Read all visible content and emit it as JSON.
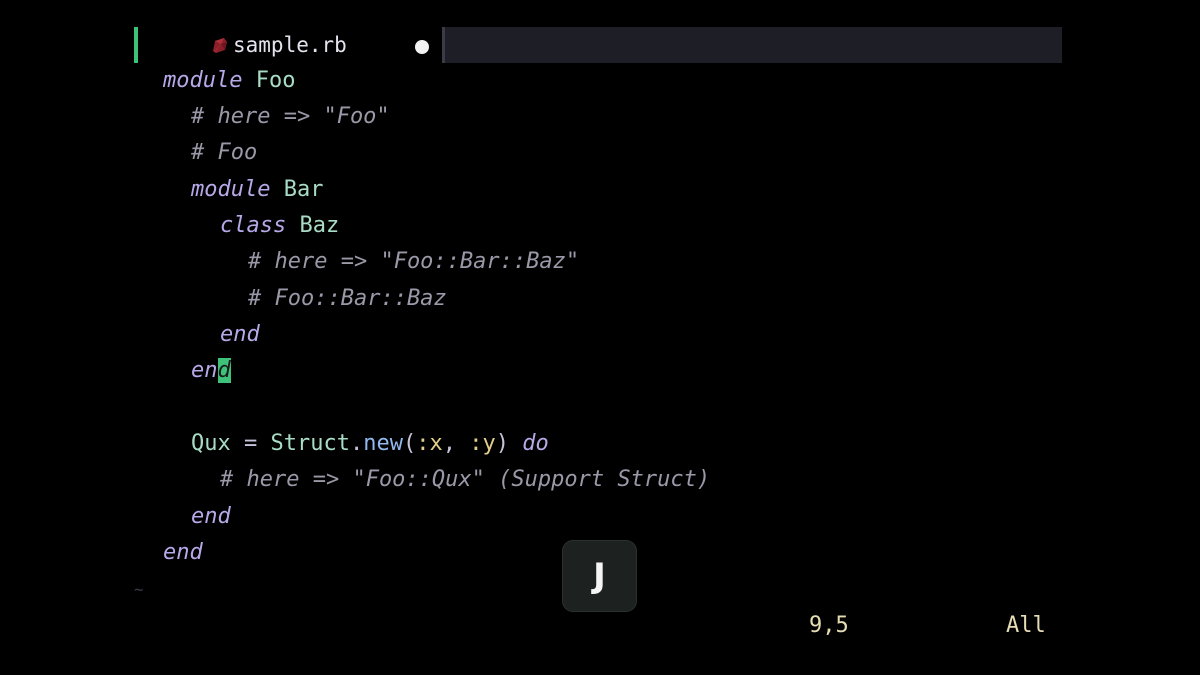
{
  "tab": {
    "filename": "sample.rb",
    "icon": "ruby-icon",
    "modified_indicator": "●"
  },
  "code": {
    "l1": {
      "kw": "module",
      "name": "Foo"
    },
    "l2": {
      "comment": "# here => \"Foo\""
    },
    "l3": {
      "comment": "# Foo"
    },
    "l4": {
      "kw": "module",
      "name": "Bar"
    },
    "l5": {
      "kw": "class",
      "name": "Baz"
    },
    "l6": {
      "comment": "# here => \"Foo::Bar::Baz\""
    },
    "l7": {
      "comment": "# Foo::Bar::Baz"
    },
    "l8": {
      "kw": "end"
    },
    "l9": {
      "kw_before_cursor": "en",
      "cursor_char": "d"
    },
    "l11": {
      "const": "Qux",
      "eq": " = ",
      "struct": "Struct",
      "dot": ".",
      "method": "new",
      "open": "(",
      "sym1": ":x",
      "comma": ", ",
      "sym2": ":y",
      "close": ")",
      "kw": "do"
    },
    "l12": {
      "comment": "# here => \"Foo::Qux\" (Support Struct)"
    },
    "l13": {
      "kw": "end"
    },
    "l14": {
      "kw": "end"
    }
  },
  "empty_line_marker": "~",
  "keypress": {
    "label": "J"
  },
  "status": {
    "cursor_position": "9,5",
    "scroll": "All"
  },
  "colors": {
    "accent_green": "#3ec27a",
    "keyword": "#b7a8e8",
    "constant": "#a9dcc6",
    "comment": "#9b98a8",
    "symbol": "#e3cf8b",
    "method": "#8fb9ee",
    "status_text": "#e6ddb4"
  }
}
